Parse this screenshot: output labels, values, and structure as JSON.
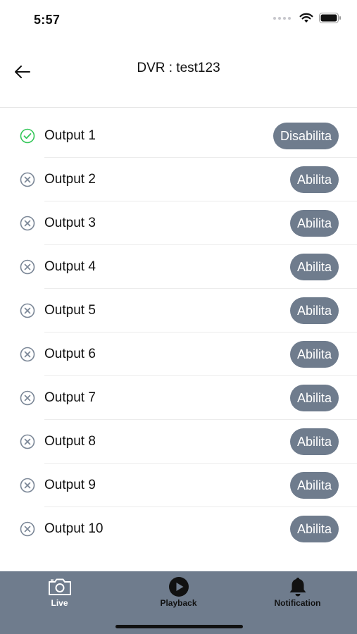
{
  "status_bar": {
    "time": "5:57"
  },
  "header": {
    "title": "DVR : test123"
  },
  "outputs": [
    {
      "label": "Output 1",
      "enabled": true,
      "button": "Disabilita"
    },
    {
      "label": "Output 2",
      "enabled": false,
      "button": "Abilita"
    },
    {
      "label": "Output 3",
      "enabled": false,
      "button": "Abilita"
    },
    {
      "label": "Output 4",
      "enabled": false,
      "button": "Abilita"
    },
    {
      "label": "Output 5",
      "enabled": false,
      "button": "Abilita"
    },
    {
      "label": "Output 6",
      "enabled": false,
      "button": "Abilita"
    },
    {
      "label": "Output 7",
      "enabled": false,
      "button": "Abilita"
    },
    {
      "label": "Output 8",
      "enabled": false,
      "button": "Abilita"
    },
    {
      "label": "Output 9",
      "enabled": false,
      "button": "Abilita"
    },
    {
      "label": "Output 10",
      "enabled": false,
      "button": "Abilita"
    }
  ],
  "tabs": [
    {
      "label": "Live",
      "icon": "camera-icon",
      "active": true
    },
    {
      "label": "Playback",
      "icon": "play-circle-icon",
      "active": false
    },
    {
      "label": "Notification",
      "icon": "bell-icon",
      "active": false
    }
  ],
  "colors": {
    "button": "#6f7c8d",
    "enabled_icon": "#34c759",
    "disabled_icon": "#7a8696",
    "tab_bar": "#6f7c8d"
  }
}
